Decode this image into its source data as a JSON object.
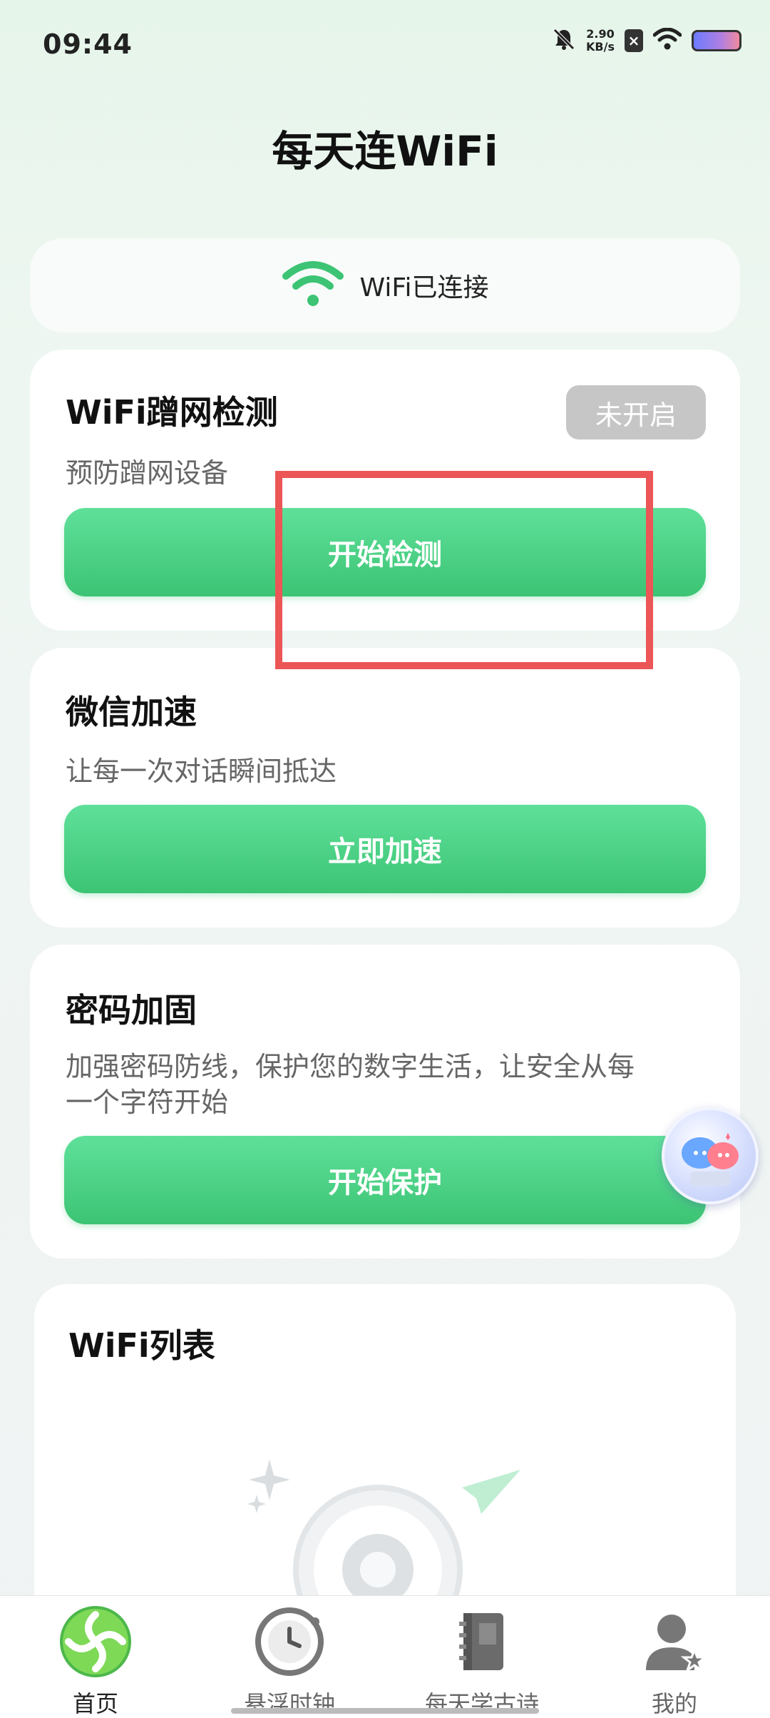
{
  "status_bar": {
    "time": "09:44",
    "net_speed_value": "2.90",
    "net_speed_unit": "KB/s",
    "icons": [
      "bell-mute-icon",
      "sim-x-icon",
      "wifi-icon",
      "battery-icon"
    ]
  },
  "app_title": "每天连WiFi",
  "wifi_status": {
    "text": "WiFi已连接",
    "icon": "wifi-icon"
  },
  "detect_card": {
    "title": "WiFi蹭网检测",
    "subtitle": "预防蹭网设备",
    "status_pill": "未开启",
    "button": "开始检测"
  },
  "wechat_card": {
    "title": "微信加速",
    "subtitle": "让每一次对话瞬间抵达",
    "button": "立即加速"
  },
  "password_card": {
    "title": "密码加固",
    "subtitle_line1": "加强密码防线，保护您的数字生活，让安全从每",
    "subtitle_line2": "一个字符开始",
    "button": "开始保护"
  },
  "wifi_list": {
    "title": "WiFi列表"
  },
  "bottom_nav": {
    "items": [
      {
        "label": "首页",
        "icon": "home-icon",
        "active": true
      },
      {
        "label": "悬浮时钟",
        "icon": "clock-icon",
        "active": false
      },
      {
        "label": "每天学古诗",
        "icon": "book-icon",
        "active": false
      },
      {
        "label": "我的",
        "icon": "user-icon",
        "active": false
      }
    ]
  },
  "colors": {
    "accent_green": "#3cc474",
    "highlight_red": "#ec5656",
    "pill_gray": "#c6c6c6"
  }
}
